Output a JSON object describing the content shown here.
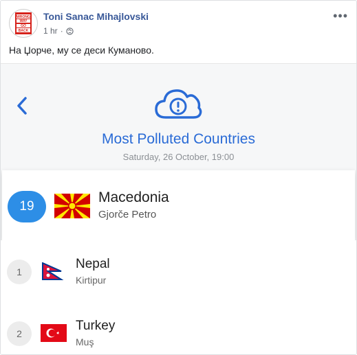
{
  "post": {
    "author": "Toni Sanac Mihajlovski",
    "time": "1 hr",
    "separator": "·",
    "more": "•••",
    "text": "На Џорче, му се деси Куманово.",
    "avatar_text": [
      "WRONG",
      "WAY",
      "GO",
      "BACK"
    ]
  },
  "screenshot": {
    "title": "Most Polluted Countries",
    "date": "Saturday, 26 October, 19:00",
    "highlight": {
      "rank": "19",
      "country": "Macedonia",
      "city": "Gjorče Petro"
    },
    "rows": [
      {
        "rank": "1",
        "country": "Nepal",
        "city": "Kirtipur"
      },
      {
        "rank": "2",
        "country": "Turkey",
        "city": "Muş"
      }
    ]
  },
  "colors": {
    "accent": "#2a6bd6",
    "author": "#385898",
    "badge": "#2d8ee6"
  }
}
